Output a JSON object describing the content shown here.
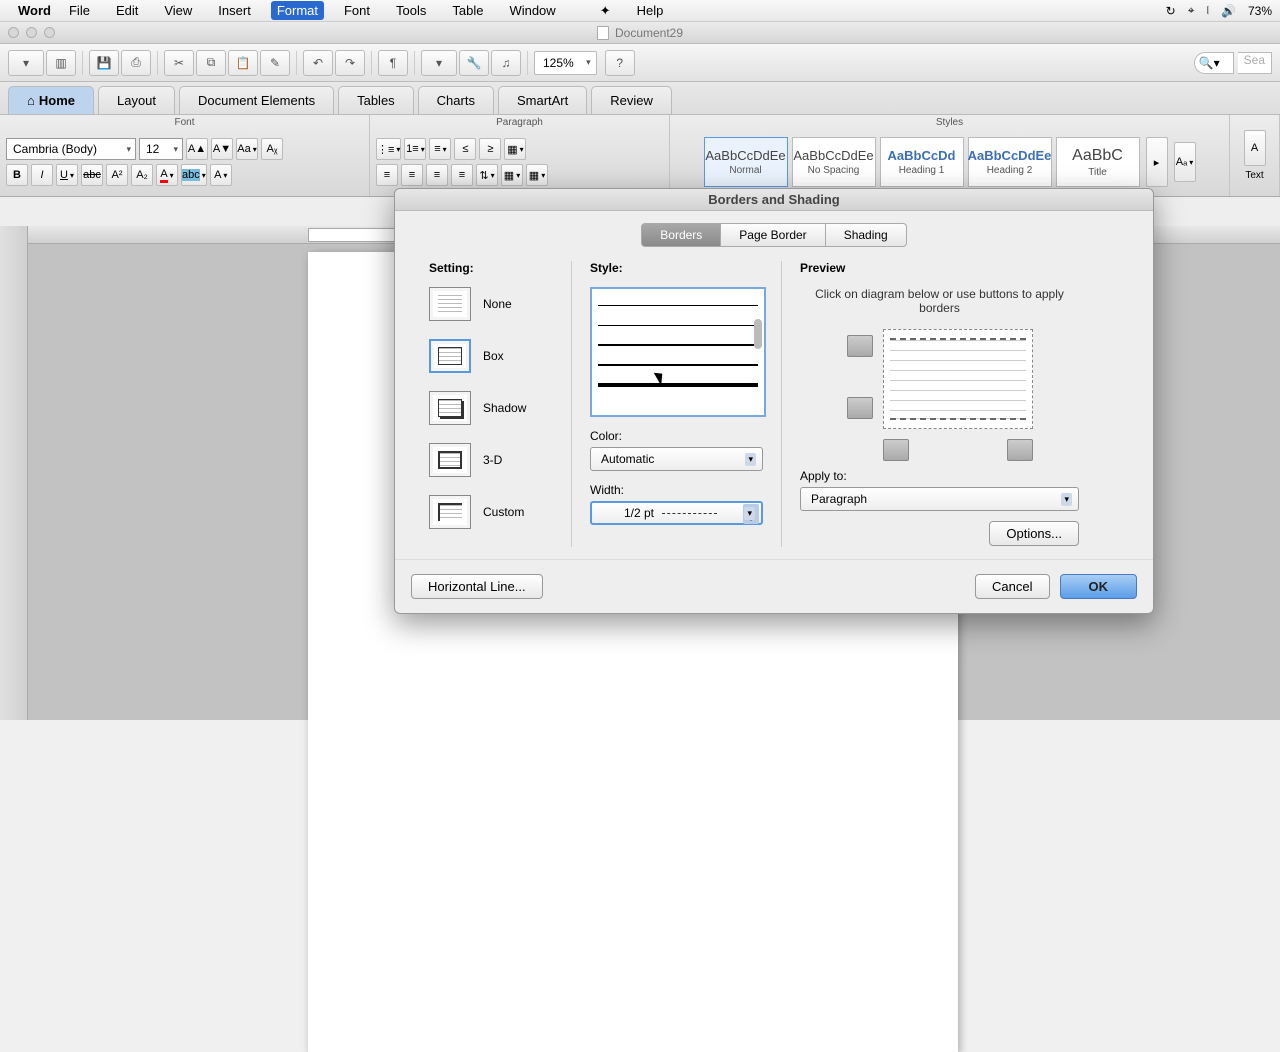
{
  "menubar": {
    "app": "Word",
    "items": [
      "File",
      "Edit",
      "View",
      "Insert",
      "Format",
      "Font",
      "Tools",
      "Table",
      "Window",
      "Help"
    ],
    "active_index": 4,
    "battery": "73%"
  },
  "window": {
    "doc_title": "Document29"
  },
  "toolbar": {
    "zoom": "125%",
    "search_placeholder": "Sea"
  },
  "ribbon": {
    "tabs": [
      "Home",
      "Layout",
      "Document Elements",
      "Tables",
      "Charts",
      "SmartArt",
      "Review"
    ],
    "active_tab": 0,
    "groups": {
      "font": "Font",
      "paragraph": "Paragraph",
      "styles": "Styles"
    },
    "font_name": "Cambria (Body)",
    "font_size": "12",
    "styles_items": [
      {
        "preview": "AaBbCcDdEe",
        "name": "Normal",
        "selected": true
      },
      {
        "preview": "AaBbCcDdEe",
        "name": "No Spacing"
      },
      {
        "preview": "AaBbCcDd",
        "name": "Heading 1"
      },
      {
        "preview": "AaBbCcDdEe",
        "name": "Heading 2"
      },
      {
        "preview": "AaBbC",
        "name": "Title"
      }
    ],
    "text_btn": "Text"
  },
  "dialog": {
    "title": "Borders and Shading",
    "tabs": [
      "Borders",
      "Page Border",
      "Shading"
    ],
    "active_tab": 0,
    "setting_label": "Setting:",
    "settings": [
      "None",
      "Box",
      "Shadow",
      "3-D",
      "Custom"
    ],
    "selected_setting": 1,
    "style_label": "Style:",
    "color_label": "Color:",
    "color_value": "Automatic",
    "width_label": "Width:",
    "width_value": "1/2 pt",
    "preview_label": "Preview",
    "preview_hint": "Click on diagram below or use buttons to apply borders",
    "apply_to_label": "Apply to:",
    "apply_to_value": "Paragraph",
    "options_btn": "Options...",
    "hline_btn": "Horizontal Line...",
    "cancel_btn": "Cancel",
    "ok_btn": "OK"
  }
}
